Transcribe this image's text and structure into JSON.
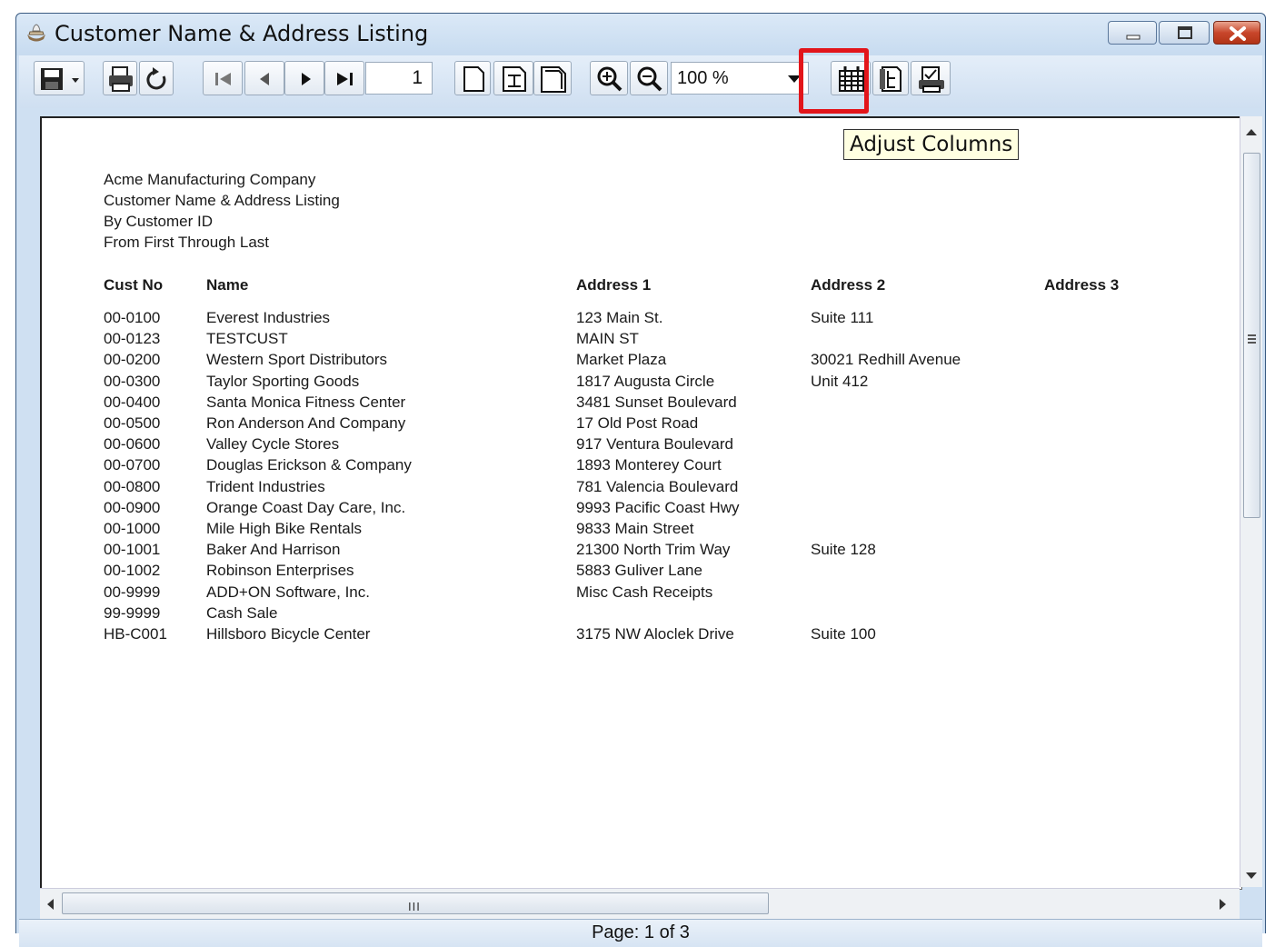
{
  "window": {
    "title": "Customer Name & Address Listing"
  },
  "toolbar": {
    "page_number": "1",
    "zoom": "100 %",
    "tooltip": "Adjust Columns",
    "highlight_color": "#e2151a"
  },
  "report": {
    "header_lines": [
      "Acme Manufacturing Company",
      "Customer Name & Address Listing",
      "By Customer ID",
      "From First Through Last"
    ],
    "columns": [
      "Cust No",
      "Name",
      "Address 1",
      "Address 2",
      "Address 3"
    ],
    "rows": [
      {
        "cust_no": "00-0100",
        "name": "Everest Industries",
        "address1": "123 Main St.",
        "address2": "Suite 111",
        "address3": ""
      },
      {
        "cust_no": "00-0123",
        "name": "TESTCUST",
        "address1": "MAIN ST",
        "address2": "",
        "address3": ""
      },
      {
        "cust_no": "00-0200",
        "name": "Western Sport Distributors",
        "address1": "Market Plaza",
        "address2": "30021 Redhill Avenue",
        "address3": ""
      },
      {
        "cust_no": "00-0300",
        "name": "Taylor Sporting Goods",
        "address1": "1817 Augusta Circle",
        "address2": "Unit 412",
        "address3": ""
      },
      {
        "cust_no": "00-0400",
        "name": "Santa Monica Fitness Center",
        "address1": "3481 Sunset Boulevard",
        "address2": "",
        "address3": ""
      },
      {
        "cust_no": "00-0500",
        "name": "Ron Anderson And Company",
        "address1": "17 Old Post Road",
        "address2": "",
        "address3": ""
      },
      {
        "cust_no": "00-0600",
        "name": "Valley Cycle Stores",
        "address1": "917 Ventura Boulevard",
        "address2": "",
        "address3": ""
      },
      {
        "cust_no": "00-0700",
        "name": "Douglas Erickson & Company",
        "address1": "1893 Monterey Court",
        "address2": "",
        "address3": ""
      },
      {
        "cust_no": "00-0800",
        "name": "Trident Industries",
        "address1": "781 Valencia Boulevard",
        "address2": "",
        "address3": ""
      },
      {
        "cust_no": "00-0900",
        "name": "Orange Coast Day Care, Inc.",
        "address1": "9993 Pacific Coast Hwy",
        "address2": "",
        "address3": ""
      },
      {
        "cust_no": "00-1000",
        "name": "Mile High Bike Rentals",
        "address1": "9833 Main Street",
        "address2": "",
        "address3": ""
      },
      {
        "cust_no": "00-1001",
        "name": "Baker And Harrison",
        "address1": "21300 North Trim Way",
        "address2": "Suite 128",
        "address3": ""
      },
      {
        "cust_no": "00-1002",
        "name": "Robinson Enterprises",
        "address1": "5883 Guliver Lane",
        "address2": "",
        "address3": ""
      },
      {
        "cust_no": "00-9999",
        "name": "ADD+ON Software, Inc.",
        "address1": "Misc Cash Receipts",
        "address2": "",
        "address3": ""
      },
      {
        "cust_no": "99-9999",
        "name": "Cash Sale",
        "address1": "",
        "address2": "",
        "address3": ""
      },
      {
        "cust_no": "HB-C001",
        "name": "Hillsboro Bicycle Center",
        "address1": "3175 NW Aloclek Drive",
        "address2": "Suite 100",
        "address3": ""
      }
    ]
  },
  "scrollbar": {
    "h_grip": "III"
  },
  "status": {
    "page_text": "Page: 1 of 3"
  }
}
